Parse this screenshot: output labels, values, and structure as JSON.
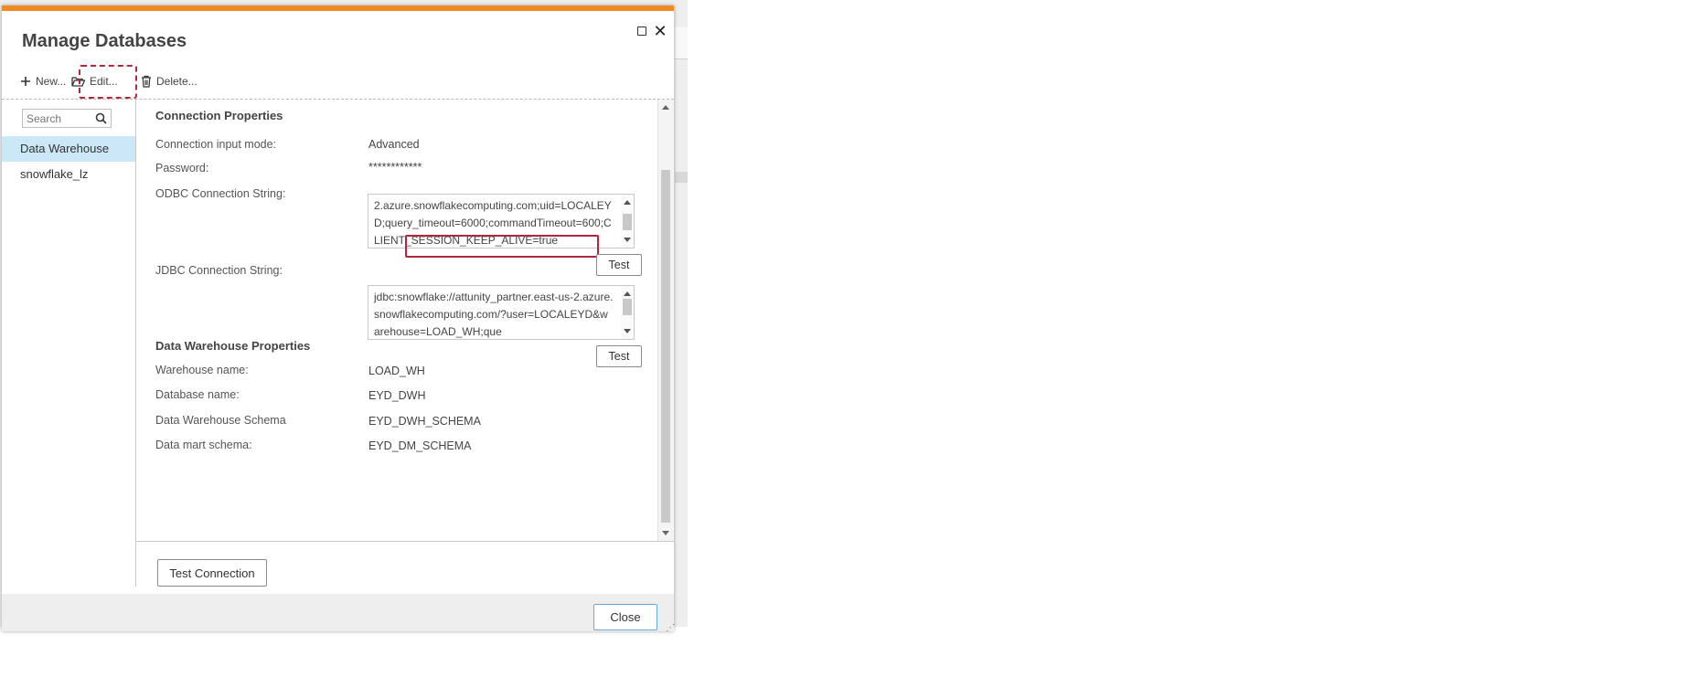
{
  "dialog": {
    "title": "Manage Databases",
    "maximize_icon": "maximize-icon",
    "close_icon": "close-icon"
  },
  "toolbar": {
    "new_label": "New...",
    "edit_label": "Edit...",
    "delete_label": "Delete..."
  },
  "sidebar": {
    "search_placeholder": "Search",
    "items": [
      {
        "label": "Data Warehouse",
        "selected": true
      },
      {
        "label": "snowflake_lz",
        "selected": false
      }
    ]
  },
  "connection": {
    "heading": "Connection Properties",
    "input_mode_label": "Connection input mode:",
    "input_mode_value": "Advanced",
    "password_label": "Password:",
    "password_value": "************",
    "odbc_label": "ODBC Connection String:",
    "odbc_value": "2.azure.snowflakecomputing.com;uid=LOCALEYD;query_timeout=6000;commandTimeout=600;CLIENT_SESSION_KEEP_ALIVE=true",
    "jdbc_label": "JDBC Connection String:",
    "jdbc_value": "jdbc:snowflake://attunity_partner.east-us-2.azure.snowflakecomputing.com/?user=LOCALEYD&warehouse=LOAD_WH;que",
    "test_label": "Test"
  },
  "warehouse": {
    "heading": "Data Warehouse Properties",
    "warehouse_name_label": "Warehouse name:",
    "warehouse_name_value": "LOAD_WH",
    "database_name_label": "Database name:",
    "database_name_value": "EYD_DWH",
    "schema_label": "Data Warehouse Schema",
    "schema_value": "EYD_DWH_SCHEMA",
    "mart_schema_label": "Data mart schema:",
    "mart_schema_value": "EYD_DM_SCHEMA"
  },
  "footer": {
    "test_connection_label": "Test Connection",
    "close_label": "Close"
  },
  "colors": {
    "accent_bar": "#f08a24",
    "selection": "#cce8f6",
    "highlight": "#b0283e"
  }
}
